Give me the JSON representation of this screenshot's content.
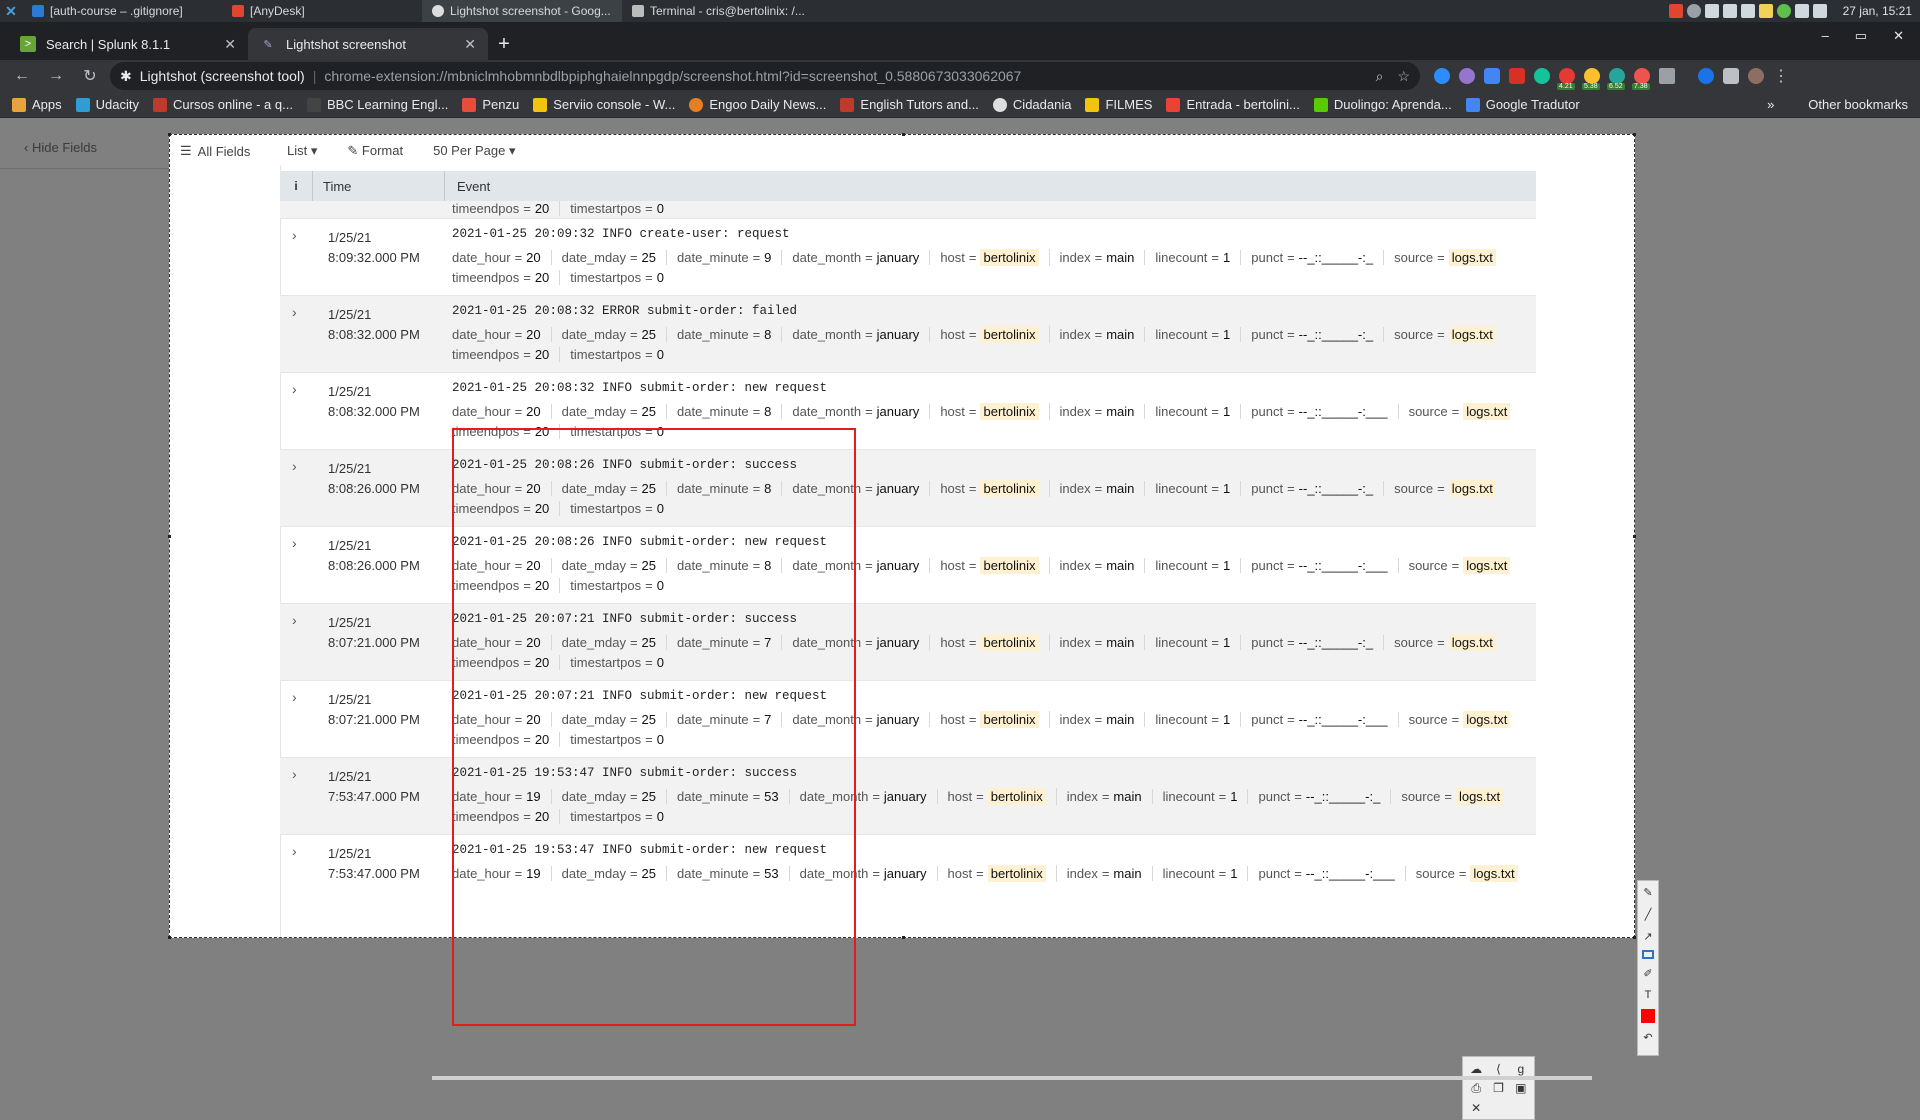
{
  "taskbar": {
    "windows": [
      {
        "label": "[auth-course – .gitignore]",
        "icon": "vscode-icon",
        "active": false
      },
      {
        "label": "[AnyDesk]",
        "icon": "anydesk-icon",
        "active": false
      },
      {
        "label": "Lightshot screenshot - Goog...",
        "icon": "chrome-icon",
        "active": true
      },
      {
        "label": "Terminal - cris@bertolinix: /...",
        "icon": "terminal-icon",
        "active": false
      }
    ],
    "clock": "27 jan, 15:21"
  },
  "browser": {
    "tabs": [
      {
        "label": "Search | Splunk 8.1.1",
        "icon": "splunk-icon",
        "active": false
      },
      {
        "label": "Lightshot screenshot",
        "icon": "lightshot-icon",
        "active": true
      }
    ],
    "site_name": "Lightshot (screenshot tool)",
    "url": "chrome-extension://mbniclmhobmnbdlbpiphghaielnnpgdp/screenshot.html?id=screenshot_0.5880673033062067",
    "extension_badges": [
      "4.21",
      "5.38",
      "6.52",
      "7.38"
    ],
    "bookmarks": [
      {
        "label": "Apps",
        "color": "#e8a33b"
      },
      {
        "label": "Udacity",
        "color": "#2f9cd8"
      },
      {
        "label": "Cursos online - a q...",
        "color": "#c0392b"
      },
      {
        "label": "BBC Learning Engl...",
        "color": "#444444"
      },
      {
        "label": "Penzu",
        "color": "#e74c3c"
      },
      {
        "label": "Serviio console - W...",
        "color": "#f1c40f"
      },
      {
        "label": "Engoo Daily News...",
        "color": "#e67e22"
      },
      {
        "label": "English Tutors and...",
        "color": "#c0392b"
      },
      {
        "label": "Cidadania",
        "color": "#dddddd"
      },
      {
        "label": "FILMES",
        "color": "#f1c40f"
      },
      {
        "label": "Entrada - bertolini...",
        "color": "#ea4335"
      },
      {
        "label": "Duolingo: Aprenda...",
        "color": "#58cc02"
      },
      {
        "label": "Google Tradutor",
        "color": "#4285f4"
      }
    ],
    "other_bookmarks": "Other bookmarks"
  },
  "splunk": {
    "hide_fields": "Hide Fields",
    "all_fields": "All Fields",
    "list_label": "List",
    "format_label": "Format",
    "per_page_label": "50 Per Page",
    "columns": {
      "info": "i",
      "time": "Time",
      "event": "Event"
    },
    "partial_row": {
      "line3": [
        {
          "k": "timeendpos",
          "v": "20"
        },
        {
          "k": "timestartpos",
          "v": "0"
        }
      ]
    },
    "rows": [
      {
        "date": "1/25/21",
        "time": "8:09:32.000 PM",
        "raw": "2021-01-25 20:09:32 INFO  create-user: request",
        "fields": [
          {
            "k": "date_hour",
            "v": "20"
          },
          {
            "k": "date_mday",
            "v": "25"
          },
          {
            "k": "date_minute",
            "v": "9"
          },
          {
            "k": "date_month",
            "v": "january"
          },
          {
            "k": "host",
            "v": "bertolinix",
            "hl": true
          },
          {
            "k": "index",
            "v": "main"
          },
          {
            "k": "linecount",
            "v": "1"
          },
          {
            "k": "punct",
            "v": "--_::_____-:_"
          },
          {
            "k": "source",
            "v": "logs.txt",
            "hl": true
          }
        ],
        "line3": [
          {
            "k": "timeendpos",
            "v": "20"
          },
          {
            "k": "timestartpos",
            "v": "0"
          }
        ]
      },
      {
        "date": "1/25/21",
        "time": "8:08:32.000 PM",
        "raw": "2021-01-25 20:08:32 ERROR submit-order: failed",
        "fields": [
          {
            "k": "date_hour",
            "v": "20"
          },
          {
            "k": "date_mday",
            "v": "25"
          },
          {
            "k": "date_minute",
            "v": "8"
          },
          {
            "k": "date_month",
            "v": "january"
          },
          {
            "k": "host",
            "v": "bertolinix",
            "hl": true
          },
          {
            "k": "index",
            "v": "main"
          },
          {
            "k": "linecount",
            "v": "1"
          },
          {
            "k": "punct",
            "v": "--_::_____-:_"
          },
          {
            "k": "source",
            "v": "logs.txt",
            "hl": true
          }
        ],
        "line3": [
          {
            "k": "timeendpos",
            "v": "20"
          },
          {
            "k": "timestartpos",
            "v": "0"
          }
        ]
      },
      {
        "date": "1/25/21",
        "time": "8:08:32.000 PM",
        "raw": "2021-01-25 20:08:32 INFO  submit-order: new request",
        "fields": [
          {
            "k": "date_hour",
            "v": "20"
          },
          {
            "k": "date_mday",
            "v": "25"
          },
          {
            "k": "date_minute",
            "v": "8"
          },
          {
            "k": "date_month",
            "v": "january"
          },
          {
            "k": "host",
            "v": "bertolinix",
            "hl": true
          },
          {
            "k": "index",
            "v": "main"
          },
          {
            "k": "linecount",
            "v": "1"
          },
          {
            "k": "punct",
            "v": "--_::_____-:___"
          },
          {
            "k": "source",
            "v": "logs.txt",
            "hl": true
          }
        ],
        "line3": [
          {
            "k": "timeendpos",
            "v": "20"
          },
          {
            "k": "timestartpos",
            "v": "0"
          }
        ]
      },
      {
        "date": "1/25/21",
        "time": "8:08:26.000 PM",
        "raw": "2021-01-25 20:08:26 INFO  submit-order: success",
        "fields": [
          {
            "k": "date_hour",
            "v": "20"
          },
          {
            "k": "date_mday",
            "v": "25"
          },
          {
            "k": "date_minute",
            "v": "8"
          },
          {
            "k": "date_month",
            "v": "january"
          },
          {
            "k": "host",
            "v": "bertolinix",
            "hl": true
          },
          {
            "k": "index",
            "v": "main"
          },
          {
            "k": "linecount",
            "v": "1"
          },
          {
            "k": "punct",
            "v": "--_::_____-:_"
          },
          {
            "k": "source",
            "v": "logs.txt",
            "hl": true
          }
        ],
        "line3": [
          {
            "k": "timeendpos",
            "v": "20"
          },
          {
            "k": "timestartpos",
            "v": "0"
          }
        ]
      },
      {
        "date": "1/25/21",
        "time": "8:08:26.000 PM",
        "raw": "2021-01-25 20:08:26 INFO  submit-order: new request",
        "fields": [
          {
            "k": "date_hour",
            "v": "20"
          },
          {
            "k": "date_mday",
            "v": "25"
          },
          {
            "k": "date_minute",
            "v": "8"
          },
          {
            "k": "date_month",
            "v": "january"
          },
          {
            "k": "host",
            "v": "bertolinix",
            "hl": true
          },
          {
            "k": "index",
            "v": "main"
          },
          {
            "k": "linecount",
            "v": "1"
          },
          {
            "k": "punct",
            "v": "--_::_____-:___"
          },
          {
            "k": "source",
            "v": "logs.txt",
            "hl": true
          }
        ],
        "line3": [
          {
            "k": "timeendpos",
            "v": "20"
          },
          {
            "k": "timestartpos",
            "v": "0"
          }
        ]
      },
      {
        "date": "1/25/21",
        "time": "8:07:21.000 PM",
        "raw": "2021-01-25 20:07:21 INFO  submit-order: success",
        "fields": [
          {
            "k": "date_hour",
            "v": "20"
          },
          {
            "k": "date_mday",
            "v": "25"
          },
          {
            "k": "date_minute",
            "v": "7"
          },
          {
            "k": "date_month",
            "v": "january"
          },
          {
            "k": "host",
            "v": "bertolinix",
            "hl": true
          },
          {
            "k": "index",
            "v": "main"
          },
          {
            "k": "linecount",
            "v": "1"
          },
          {
            "k": "punct",
            "v": "--_::_____-:_"
          },
          {
            "k": "source",
            "v": "logs.txt",
            "hl": true
          }
        ],
        "line3": [
          {
            "k": "timeendpos",
            "v": "20"
          },
          {
            "k": "timestartpos",
            "v": "0"
          }
        ]
      },
      {
        "date": "1/25/21",
        "time": "8:07:21.000 PM",
        "raw": "2021-01-25 20:07:21 INFO  submit-order: new request",
        "fields": [
          {
            "k": "date_hour",
            "v": "20"
          },
          {
            "k": "date_mday",
            "v": "25"
          },
          {
            "k": "date_minute",
            "v": "7"
          },
          {
            "k": "date_month",
            "v": "january"
          },
          {
            "k": "host",
            "v": "bertolinix",
            "hl": true
          },
          {
            "k": "index",
            "v": "main"
          },
          {
            "k": "linecount",
            "v": "1"
          },
          {
            "k": "punct",
            "v": "--_::_____-:___"
          },
          {
            "k": "source",
            "v": "logs.txt",
            "hl": true
          }
        ],
        "line3": [
          {
            "k": "timeendpos",
            "v": "20"
          },
          {
            "k": "timestartpos",
            "v": "0"
          }
        ]
      },
      {
        "date": "1/25/21",
        "time": "7:53:47.000 PM",
        "raw": "2021-01-25 19:53:47 INFO  submit-order: success",
        "fields": [
          {
            "k": "date_hour",
            "v": "19"
          },
          {
            "k": "date_mday",
            "v": "25"
          },
          {
            "k": "date_minute",
            "v": "53"
          },
          {
            "k": "date_month",
            "v": "january"
          },
          {
            "k": "host",
            "v": "bertolinix",
            "hl": true
          },
          {
            "k": "index",
            "v": "main"
          },
          {
            "k": "linecount",
            "v": "1"
          },
          {
            "k": "punct",
            "v": "--_::_____-:_"
          },
          {
            "k": "source",
            "v": "logs.txt",
            "hl": true
          }
        ],
        "line3": [
          {
            "k": "timeendpos",
            "v": "20"
          },
          {
            "k": "timestartpos",
            "v": "0"
          }
        ]
      },
      {
        "date": "1/25/21",
        "time": "7:53:47.000 PM",
        "raw": "2021-01-25 19:53:47 INFO  submit-order: new request",
        "fields": [
          {
            "k": "date_hour",
            "v": "19"
          },
          {
            "k": "date_mday",
            "v": "25"
          },
          {
            "k": "date_minute",
            "v": "53"
          },
          {
            "k": "date_month",
            "v": "january"
          },
          {
            "k": "host",
            "v": "bertolinix",
            "hl": true
          },
          {
            "k": "index",
            "v": "main"
          },
          {
            "k": "linecount",
            "v": "1"
          },
          {
            "k": "punct",
            "v": "--_::_____-:___"
          },
          {
            "k": "source",
            "v": "logs.txt",
            "hl": true
          }
        ],
        "line3": []
      }
    ]
  },
  "annotation": {
    "box_color": "#e31c1c",
    "active_color": "#ff0000"
  },
  "lightshot_tools": [
    "pen-icon",
    "line-icon",
    "arrow-icon",
    "rectangle-icon",
    "marker-icon",
    "text-icon",
    "color-swatch",
    "undo-icon"
  ],
  "lightshot_actions": [
    "upload-icon",
    "share-icon",
    "search-similar-icon",
    "print-icon",
    "copy-icon",
    "save-icon",
    "close-icon"
  ]
}
